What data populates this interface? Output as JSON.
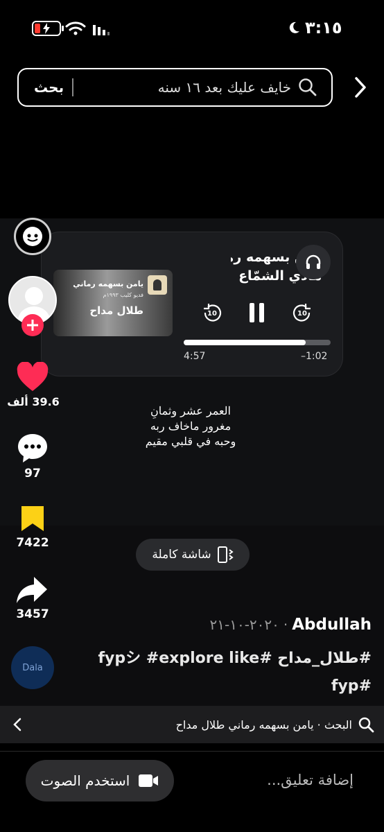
{
  "status_bar": {
    "time": "٣:١٥"
  },
  "search": {
    "query": "خايف عليك بعد ١٦ سنه",
    "button_label": "بحث"
  },
  "music_card": {
    "title": "يامن بسهمه رمانـ",
    "artist": "هادي الشمّاع",
    "elapsed": "4:57",
    "remaining": "–1:02",
    "progress": 0.83,
    "skip_back_seconds": "10",
    "skip_forward_seconds": "10",
    "album_art": {
      "line1": "يامن بسهمه رماني",
      "line2": "فديو كليب ١٩٩٣م",
      "line3": "طلال مداح"
    }
  },
  "lyrics": [
    "العمر عشر وثمانِ",
    "مغرور ماخاف ربه",
    "وحبه في قلبي مقيم"
  ],
  "side_rail": {
    "likes": "39.6 ألف",
    "comments": "97",
    "bookmarks": "7422",
    "shares": "3457",
    "disc_label": "Dala"
  },
  "fullscreen_label": "شاشة كاملة",
  "post": {
    "author": "Abdullah",
    "date": "٢٠٢٠-١٠-٢١",
    "caption": "#طلال_مداح #fypシ #explore like",
    "caption_line2": "#fyp"
  },
  "search_suggestion": {
    "text": "البحث · يامن بسهمه رماني طلال مداح"
  },
  "bottom_bar": {
    "comment_placeholder": "إضافة تعليق...",
    "use_sound_label": "استخدم الصوت"
  },
  "colors": {
    "like": "#fe2c55",
    "bookmark": "#fcd116",
    "follow": "#fe2c55"
  }
}
